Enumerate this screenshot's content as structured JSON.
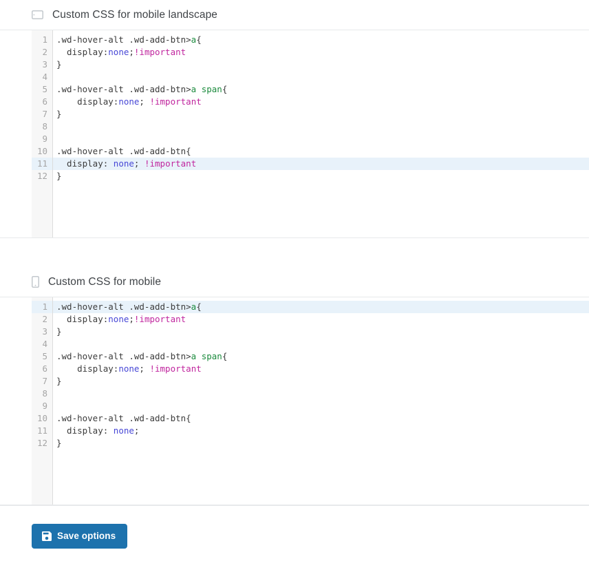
{
  "sections": [
    {
      "icon": "mobile-landscape-icon",
      "label": "Custom CSS for mobile landscape",
      "editor": {
        "active_line": 11,
        "lines": [
          {
            "n": "1",
            "tokens": [
              {
                "t": ".wd-hover-alt .wd-add-btn>",
                "c": "t-sel"
              },
              {
                "t": "a",
                "c": "t-tag"
              },
              {
                "t": "{",
                "c": "t-punc"
              }
            ]
          },
          {
            "n": "2",
            "tokens": [
              {
                "t": "  display:",
                "c": "t-prop"
              },
              {
                "t": "none",
                "c": "t-val"
              },
              {
                "t": ";",
                "c": "t-punc"
              },
              {
                "t": "!important",
                "c": "t-imp"
              }
            ]
          },
          {
            "n": "3",
            "tokens": [
              {
                "t": "}",
                "c": "t-punc"
              }
            ]
          },
          {
            "n": "4",
            "tokens": [
              {
                "t": "",
                "c": "t-sel"
              }
            ]
          },
          {
            "n": "5",
            "tokens": [
              {
                "t": ".wd-hover-alt .wd-add-btn>",
                "c": "t-sel"
              },
              {
                "t": "a",
                "c": "t-tag"
              },
              {
                "t": " ",
                "c": "t-sel"
              },
              {
                "t": "span",
                "c": "t-tag"
              },
              {
                "t": "{",
                "c": "t-punc"
              }
            ]
          },
          {
            "n": "6",
            "tokens": [
              {
                "t": "    display:",
                "c": "t-prop"
              },
              {
                "t": "none",
                "c": "t-val"
              },
              {
                "t": "; ",
                "c": "t-punc"
              },
              {
                "t": "!important",
                "c": "t-imp"
              }
            ]
          },
          {
            "n": "7",
            "tokens": [
              {
                "t": "}",
                "c": "t-punc"
              }
            ]
          },
          {
            "n": "8",
            "tokens": [
              {
                "t": "",
                "c": "t-sel"
              }
            ]
          },
          {
            "n": "9",
            "tokens": [
              {
                "t": "",
                "c": "t-sel"
              }
            ]
          },
          {
            "n": "10",
            "tokens": [
              {
                "t": ".wd-hover-alt .wd-add-btn",
                "c": "t-sel"
              },
              {
                "t": "{",
                "c": "t-punc"
              }
            ]
          },
          {
            "n": "11",
            "tokens": [
              {
                "t": "  display: ",
                "c": "t-prop"
              },
              {
                "t": "none",
                "c": "t-val"
              },
              {
                "t": "; ",
                "c": "t-punc"
              },
              {
                "t": "!important",
                "c": "t-imp"
              }
            ]
          },
          {
            "n": "12",
            "tokens": [
              {
                "t": "}",
                "c": "t-punc"
              }
            ]
          }
        ]
      }
    },
    {
      "icon": "mobile-portrait-icon",
      "label": "Custom CSS for mobile",
      "editor": {
        "active_line": 1,
        "lines": [
          {
            "n": "1",
            "tokens": [
              {
                "t": ".wd-hover-alt .wd-add-btn>",
                "c": "t-sel"
              },
              {
                "t": "a",
                "c": "t-tag"
              },
              {
                "t": "{",
                "c": "t-punc"
              }
            ]
          },
          {
            "n": "2",
            "tokens": [
              {
                "t": "  display:",
                "c": "t-prop"
              },
              {
                "t": "none",
                "c": "t-val"
              },
              {
                "t": ";",
                "c": "t-punc"
              },
              {
                "t": "!important",
                "c": "t-imp"
              }
            ]
          },
          {
            "n": "3",
            "tokens": [
              {
                "t": "}",
                "c": "t-punc"
              }
            ]
          },
          {
            "n": "4",
            "tokens": [
              {
                "t": "",
                "c": "t-sel"
              }
            ]
          },
          {
            "n": "5",
            "tokens": [
              {
                "t": ".wd-hover-alt .wd-add-btn>",
                "c": "t-sel"
              },
              {
                "t": "a",
                "c": "t-tag"
              },
              {
                "t": " ",
                "c": "t-sel"
              },
              {
                "t": "span",
                "c": "t-tag"
              },
              {
                "t": "{",
                "c": "t-punc"
              }
            ]
          },
          {
            "n": "6",
            "tokens": [
              {
                "t": "    display:",
                "c": "t-prop"
              },
              {
                "t": "none",
                "c": "t-val"
              },
              {
                "t": "; ",
                "c": "t-punc"
              },
              {
                "t": "!important",
                "c": "t-imp"
              }
            ]
          },
          {
            "n": "7",
            "tokens": [
              {
                "t": "}",
                "c": "t-punc"
              }
            ]
          },
          {
            "n": "8",
            "tokens": [
              {
                "t": "",
                "c": "t-sel"
              }
            ]
          },
          {
            "n": "9",
            "tokens": [
              {
                "t": "",
                "c": "t-sel"
              }
            ]
          },
          {
            "n": "10",
            "tokens": [
              {
                "t": ".wd-hover-alt .wd-add-btn",
                "c": "t-sel"
              },
              {
                "t": "{",
                "c": "t-punc"
              }
            ]
          },
          {
            "n": "11",
            "tokens": [
              {
                "t": "  display: ",
                "c": "t-prop"
              },
              {
                "t": "none",
                "c": "t-val"
              },
              {
                "t": ";",
                "c": "t-punc"
              }
            ]
          },
          {
            "n": "12",
            "tokens": [
              {
                "t": "}",
                "c": "t-punc"
              }
            ]
          }
        ]
      }
    }
  ],
  "footer": {
    "save_label": "Save options",
    "save_icon": "floppy-disk-icon"
  },
  "colors": {
    "accent": "#1d72ad",
    "active_line": "#e8f2fa",
    "gutter_bg": "#f7f7f7",
    "divider": "#e7e9eb",
    "token_tag": "#1a8a3c",
    "token_value": "#4646d6",
    "token_important": "#c0259e"
  }
}
